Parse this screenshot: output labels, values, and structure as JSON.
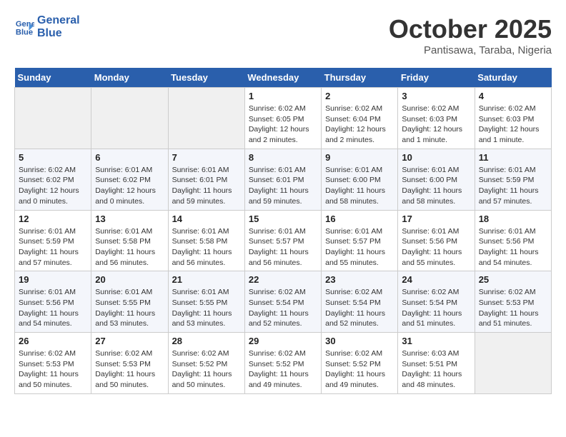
{
  "logo": {
    "line1": "General",
    "line2": "Blue"
  },
  "title": "October 2025",
  "subtitle": "Pantisawa, Taraba, Nigeria",
  "days_of_week": [
    "Sunday",
    "Monday",
    "Tuesday",
    "Wednesday",
    "Thursday",
    "Friday",
    "Saturday"
  ],
  "weeks": [
    [
      {
        "day": "",
        "empty": true
      },
      {
        "day": "",
        "empty": true
      },
      {
        "day": "",
        "empty": true
      },
      {
        "day": "1",
        "sunrise": "Sunrise: 6:02 AM",
        "sunset": "Sunset: 6:05 PM",
        "daylight": "Daylight: 12 hours and 2 minutes."
      },
      {
        "day": "2",
        "sunrise": "Sunrise: 6:02 AM",
        "sunset": "Sunset: 6:04 PM",
        "daylight": "Daylight: 12 hours and 2 minutes."
      },
      {
        "day": "3",
        "sunrise": "Sunrise: 6:02 AM",
        "sunset": "Sunset: 6:03 PM",
        "daylight": "Daylight: 12 hours and 1 minute."
      },
      {
        "day": "4",
        "sunrise": "Sunrise: 6:02 AM",
        "sunset": "Sunset: 6:03 PM",
        "daylight": "Daylight: 12 hours and 1 minute."
      }
    ],
    [
      {
        "day": "5",
        "sunrise": "Sunrise: 6:02 AM",
        "sunset": "Sunset: 6:02 PM",
        "daylight": "Daylight: 12 hours and 0 minutes."
      },
      {
        "day": "6",
        "sunrise": "Sunrise: 6:01 AM",
        "sunset": "Sunset: 6:02 PM",
        "daylight": "Daylight: 12 hours and 0 minutes."
      },
      {
        "day": "7",
        "sunrise": "Sunrise: 6:01 AM",
        "sunset": "Sunset: 6:01 PM",
        "daylight": "Daylight: 11 hours and 59 minutes."
      },
      {
        "day": "8",
        "sunrise": "Sunrise: 6:01 AM",
        "sunset": "Sunset: 6:01 PM",
        "daylight": "Daylight: 11 hours and 59 minutes."
      },
      {
        "day": "9",
        "sunrise": "Sunrise: 6:01 AM",
        "sunset": "Sunset: 6:00 PM",
        "daylight": "Daylight: 11 hours and 58 minutes."
      },
      {
        "day": "10",
        "sunrise": "Sunrise: 6:01 AM",
        "sunset": "Sunset: 6:00 PM",
        "daylight": "Daylight: 11 hours and 58 minutes."
      },
      {
        "day": "11",
        "sunrise": "Sunrise: 6:01 AM",
        "sunset": "Sunset: 5:59 PM",
        "daylight": "Daylight: 11 hours and 57 minutes."
      }
    ],
    [
      {
        "day": "12",
        "sunrise": "Sunrise: 6:01 AM",
        "sunset": "Sunset: 5:59 PM",
        "daylight": "Daylight: 11 hours and 57 minutes."
      },
      {
        "day": "13",
        "sunrise": "Sunrise: 6:01 AM",
        "sunset": "Sunset: 5:58 PM",
        "daylight": "Daylight: 11 hours and 56 minutes."
      },
      {
        "day": "14",
        "sunrise": "Sunrise: 6:01 AM",
        "sunset": "Sunset: 5:58 PM",
        "daylight": "Daylight: 11 hours and 56 minutes."
      },
      {
        "day": "15",
        "sunrise": "Sunrise: 6:01 AM",
        "sunset": "Sunset: 5:57 PM",
        "daylight": "Daylight: 11 hours and 56 minutes."
      },
      {
        "day": "16",
        "sunrise": "Sunrise: 6:01 AM",
        "sunset": "Sunset: 5:57 PM",
        "daylight": "Daylight: 11 hours and 55 minutes."
      },
      {
        "day": "17",
        "sunrise": "Sunrise: 6:01 AM",
        "sunset": "Sunset: 5:56 PM",
        "daylight": "Daylight: 11 hours and 55 minutes."
      },
      {
        "day": "18",
        "sunrise": "Sunrise: 6:01 AM",
        "sunset": "Sunset: 5:56 PM",
        "daylight": "Daylight: 11 hours and 54 minutes."
      }
    ],
    [
      {
        "day": "19",
        "sunrise": "Sunrise: 6:01 AM",
        "sunset": "Sunset: 5:56 PM",
        "daylight": "Daylight: 11 hours and 54 minutes."
      },
      {
        "day": "20",
        "sunrise": "Sunrise: 6:01 AM",
        "sunset": "Sunset: 5:55 PM",
        "daylight": "Daylight: 11 hours and 53 minutes."
      },
      {
        "day": "21",
        "sunrise": "Sunrise: 6:01 AM",
        "sunset": "Sunset: 5:55 PM",
        "daylight": "Daylight: 11 hours and 53 minutes."
      },
      {
        "day": "22",
        "sunrise": "Sunrise: 6:02 AM",
        "sunset": "Sunset: 5:54 PM",
        "daylight": "Daylight: 11 hours and 52 minutes."
      },
      {
        "day": "23",
        "sunrise": "Sunrise: 6:02 AM",
        "sunset": "Sunset: 5:54 PM",
        "daylight": "Daylight: 11 hours and 52 minutes."
      },
      {
        "day": "24",
        "sunrise": "Sunrise: 6:02 AM",
        "sunset": "Sunset: 5:54 PM",
        "daylight": "Daylight: 11 hours and 51 minutes."
      },
      {
        "day": "25",
        "sunrise": "Sunrise: 6:02 AM",
        "sunset": "Sunset: 5:53 PM",
        "daylight": "Daylight: 11 hours and 51 minutes."
      }
    ],
    [
      {
        "day": "26",
        "sunrise": "Sunrise: 6:02 AM",
        "sunset": "Sunset: 5:53 PM",
        "daylight": "Daylight: 11 hours and 50 minutes."
      },
      {
        "day": "27",
        "sunrise": "Sunrise: 6:02 AM",
        "sunset": "Sunset: 5:53 PM",
        "daylight": "Daylight: 11 hours and 50 minutes."
      },
      {
        "day": "28",
        "sunrise": "Sunrise: 6:02 AM",
        "sunset": "Sunset: 5:52 PM",
        "daylight": "Daylight: 11 hours and 50 minutes."
      },
      {
        "day": "29",
        "sunrise": "Sunrise: 6:02 AM",
        "sunset": "Sunset: 5:52 PM",
        "daylight": "Daylight: 11 hours and 49 minutes."
      },
      {
        "day": "30",
        "sunrise": "Sunrise: 6:02 AM",
        "sunset": "Sunset: 5:52 PM",
        "daylight": "Daylight: 11 hours and 49 minutes."
      },
      {
        "day": "31",
        "sunrise": "Sunrise: 6:03 AM",
        "sunset": "Sunset: 5:51 PM",
        "daylight": "Daylight: 11 hours and 48 minutes."
      },
      {
        "day": "",
        "empty": true
      }
    ]
  ]
}
